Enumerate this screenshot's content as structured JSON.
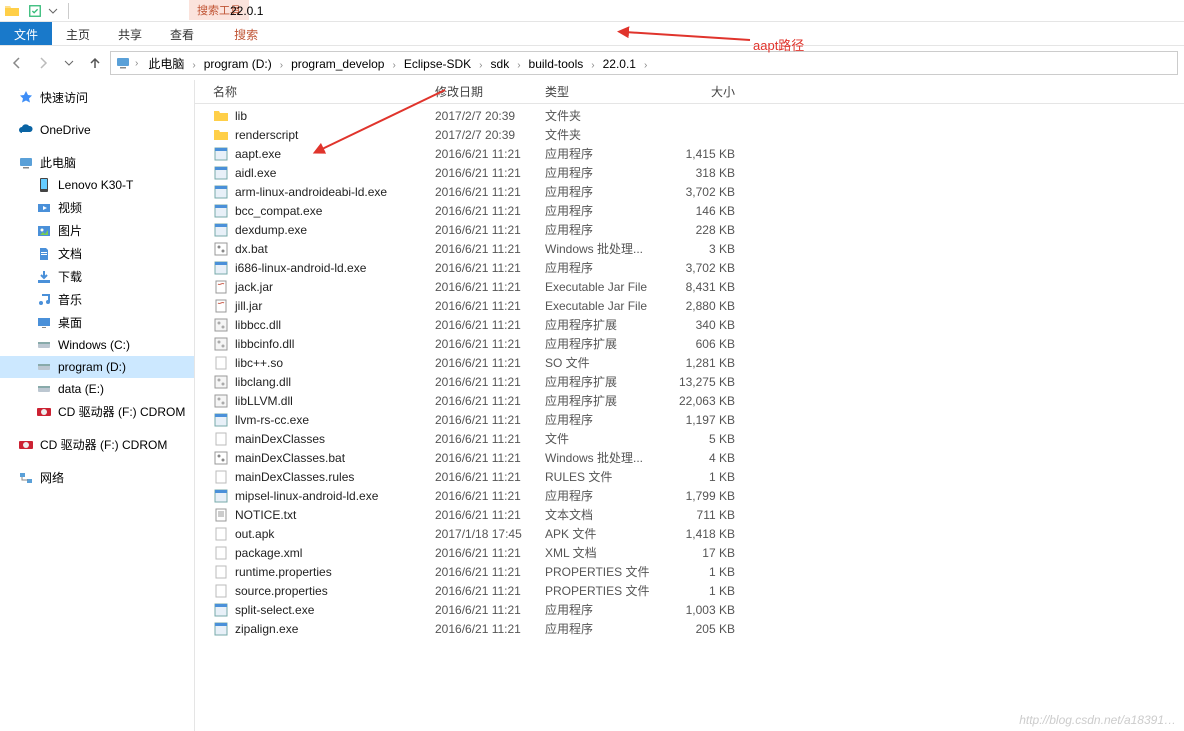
{
  "titlebar": {
    "search_tools_label": "搜索工具",
    "window_title": "22.0.1"
  },
  "ribbon": {
    "file": "文件",
    "home": "主页",
    "share": "共享",
    "view": "查看",
    "search": "搜索"
  },
  "breadcrumbs": [
    "此电脑",
    "program (D:)",
    "program_develop",
    "Eclipse-SDK",
    "sdk",
    "build-tools",
    "22.0.1"
  ],
  "sidebar": {
    "quick_access": "快速访问",
    "onedrive": "OneDrive",
    "this_pc": "此电脑",
    "children": [
      {
        "label": "Lenovo K30-T",
        "ico": "phone"
      },
      {
        "label": "视频",
        "ico": "videos"
      },
      {
        "label": "图片",
        "ico": "pictures"
      },
      {
        "label": "文档",
        "ico": "documents"
      },
      {
        "label": "下载",
        "ico": "downloads"
      },
      {
        "label": "音乐",
        "ico": "music"
      },
      {
        "label": "桌面",
        "ico": "desktop"
      },
      {
        "label": "Windows (C:)",
        "ico": "drive"
      },
      {
        "label": "program (D:)",
        "ico": "drive",
        "selected": true
      },
      {
        "label": "data (E:)",
        "ico": "drive"
      },
      {
        "label": "CD 驱动器 (F:) CDROM",
        "ico": "cd"
      }
    ],
    "cd2": "CD 驱动器 (F:) CDROM",
    "network": "网络"
  },
  "columns": {
    "name": "名称",
    "date": "修改日期",
    "type": "类型",
    "size": "大小"
  },
  "files": [
    {
      "name": "lib",
      "date": "2017/2/7 20:39",
      "type": "文件夹",
      "size": "",
      "ico": "folder"
    },
    {
      "name": "renderscript",
      "date": "2017/2/7 20:39",
      "type": "文件夹",
      "size": "",
      "ico": "folder"
    },
    {
      "name": "aapt.exe",
      "date": "2016/6/21 11:21",
      "type": "应用程序",
      "size": "1,415 KB",
      "ico": "exe"
    },
    {
      "name": "aidl.exe",
      "date": "2016/6/21 11:21",
      "type": "应用程序",
      "size": "318 KB",
      "ico": "exe"
    },
    {
      "name": "arm-linux-androideabi-ld.exe",
      "date": "2016/6/21 11:21",
      "type": "应用程序",
      "size": "3,702 KB",
      "ico": "exe"
    },
    {
      "name": "bcc_compat.exe",
      "date": "2016/6/21 11:21",
      "type": "应用程序",
      "size": "146 KB",
      "ico": "exe"
    },
    {
      "name": "dexdump.exe",
      "date": "2016/6/21 11:21",
      "type": "应用程序",
      "size": "228 KB",
      "ico": "exe"
    },
    {
      "name": "dx.bat",
      "date": "2016/6/21 11:21",
      "type": "Windows 批处理...",
      "size": "3 KB",
      "ico": "bat"
    },
    {
      "name": "i686-linux-android-ld.exe",
      "date": "2016/6/21 11:21",
      "type": "应用程序",
      "size": "3,702 KB",
      "ico": "exe"
    },
    {
      "name": "jack.jar",
      "date": "2016/6/21 11:21",
      "type": "Executable Jar File",
      "size": "8,431 KB",
      "ico": "jar"
    },
    {
      "name": "jill.jar",
      "date": "2016/6/21 11:21",
      "type": "Executable Jar File",
      "size": "2,880 KB",
      "ico": "jar"
    },
    {
      "name": "libbcc.dll",
      "date": "2016/6/21 11:21",
      "type": "应用程序扩展",
      "size": "340 KB",
      "ico": "dll"
    },
    {
      "name": "libbcinfo.dll",
      "date": "2016/6/21 11:21",
      "type": "应用程序扩展",
      "size": "606 KB",
      "ico": "dll"
    },
    {
      "name": "libc++.so",
      "date": "2016/6/21 11:21",
      "type": "SO 文件",
      "size": "1,281 KB",
      "ico": "file"
    },
    {
      "name": "libclang.dll",
      "date": "2016/6/21 11:21",
      "type": "应用程序扩展",
      "size": "13,275 KB",
      "ico": "dll"
    },
    {
      "name": "libLLVM.dll",
      "date": "2016/6/21 11:21",
      "type": "应用程序扩展",
      "size": "22,063 KB",
      "ico": "dll"
    },
    {
      "name": "llvm-rs-cc.exe",
      "date": "2016/6/21 11:21",
      "type": "应用程序",
      "size": "1,197 KB",
      "ico": "exe"
    },
    {
      "name": "mainDexClasses",
      "date": "2016/6/21 11:21",
      "type": "文件",
      "size": "5 KB",
      "ico": "file"
    },
    {
      "name": "mainDexClasses.bat",
      "date": "2016/6/21 11:21",
      "type": "Windows 批处理...",
      "size": "4 KB",
      "ico": "bat"
    },
    {
      "name": "mainDexClasses.rules",
      "date": "2016/6/21 11:21",
      "type": "RULES 文件",
      "size": "1 KB",
      "ico": "file"
    },
    {
      "name": "mipsel-linux-android-ld.exe",
      "date": "2016/6/21 11:21",
      "type": "应用程序",
      "size": "1,799 KB",
      "ico": "exe"
    },
    {
      "name": "NOTICE.txt",
      "date": "2016/6/21 11:21",
      "type": "文本文档",
      "size": "711 KB",
      "ico": "txt"
    },
    {
      "name": "out.apk",
      "date": "2017/1/18 17:45",
      "type": "APK 文件",
      "size": "1,418 KB",
      "ico": "file"
    },
    {
      "name": "package.xml",
      "date": "2016/6/21 11:21",
      "type": "XML 文档",
      "size": "17 KB",
      "ico": "file"
    },
    {
      "name": "runtime.properties",
      "date": "2016/6/21 11:21",
      "type": "PROPERTIES 文件",
      "size": "1 KB",
      "ico": "file"
    },
    {
      "name": "source.properties",
      "date": "2016/6/21 11:21",
      "type": "PROPERTIES 文件",
      "size": "1 KB",
      "ico": "file"
    },
    {
      "name": "split-select.exe",
      "date": "2016/6/21 11:21",
      "type": "应用程序",
      "size": "1,003 KB",
      "ico": "exe"
    },
    {
      "name": "zipalign.exe",
      "date": "2016/6/21 11:21",
      "type": "应用程序",
      "size": "205 KB",
      "ico": "exe"
    }
  ],
  "annotation": {
    "label": "aapt路径"
  },
  "watermark": "http://blog.csdn.net/a18391…"
}
